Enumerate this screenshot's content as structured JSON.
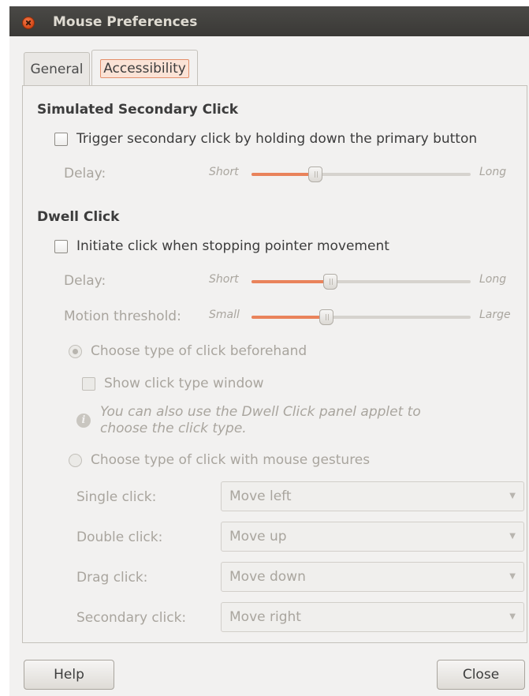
{
  "window": {
    "title": "Mouse Preferences"
  },
  "tabs": [
    {
      "label": "General",
      "active": false
    },
    {
      "label": "Accessibility",
      "active": true
    }
  ],
  "secondary_click": {
    "title": "Simulated Secondary Click",
    "checkbox_label": "Trigger secondary click by holding down the primary button",
    "checked": false,
    "delay_label": "Delay:",
    "delay_min": "Short",
    "delay_max": "Long",
    "delay_value": 0.29
  },
  "dwell_click": {
    "title": "Dwell Click",
    "checkbox_label": "Initiate click when stopping pointer movement",
    "checked": false,
    "delay_label": "Delay:",
    "delay_min": "Short",
    "delay_max": "Long",
    "delay_value": 0.36,
    "threshold_label": "Motion threshold:",
    "threshold_min": "Small",
    "threshold_max": "Large",
    "threshold_value": 0.34,
    "radio_beforehand": "Choose type of click beforehand",
    "show_click_window": "Show click type window",
    "info_text": "You can also use the Dwell Click panel applet to choose the click type.",
    "radio_gestures": "Choose type of click with mouse gestures",
    "gestures": [
      {
        "label": "Single click:",
        "value": "Move left"
      },
      {
        "label": "Double click:",
        "value": "Move up"
      },
      {
        "label": "Drag click:",
        "value": "Move down"
      },
      {
        "label": "Secondary click:",
        "value": "Move right"
      }
    ]
  },
  "buttons": {
    "help": "Help",
    "close": "Close"
  },
  "colors": {
    "accent": "#e9835b",
    "titlebar": "#3c3b37",
    "close_button": "#df4a16"
  }
}
